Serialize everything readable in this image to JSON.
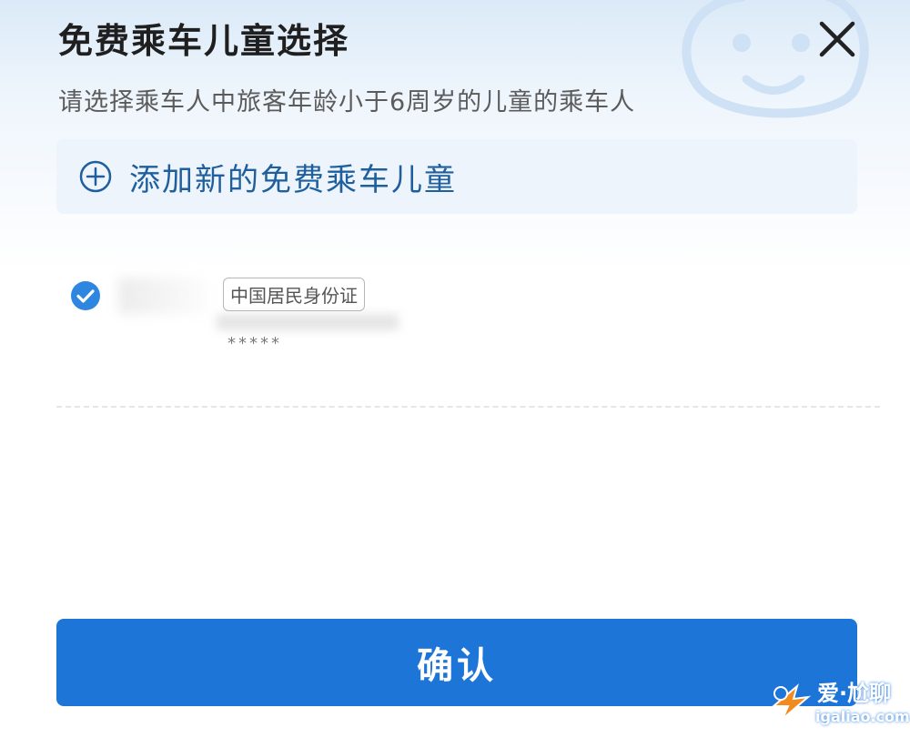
{
  "header": {
    "title": "免费乘车儿童选择",
    "subtitle": "请选择乘车人中旅客年龄小于6周岁的儿童的乘车人"
  },
  "add_child": {
    "label": "添加新的免费乘车儿童"
  },
  "passengers": [
    {
      "selected": true,
      "id_type": "中国居民身份证",
      "id_masked": "*****"
    }
  ],
  "footer": {
    "confirm_label": "确认"
  },
  "watermark": {
    "text": "爱·尬聊",
    "url": "igaliao.com"
  },
  "colors": {
    "accent": "#1d75d8",
    "add_text": "#1f5f9e",
    "add_bg": "#eef4fb"
  },
  "icons": [
    "close-icon",
    "plus-circle-icon",
    "check-circle-icon",
    "baby-face-icon"
  ]
}
